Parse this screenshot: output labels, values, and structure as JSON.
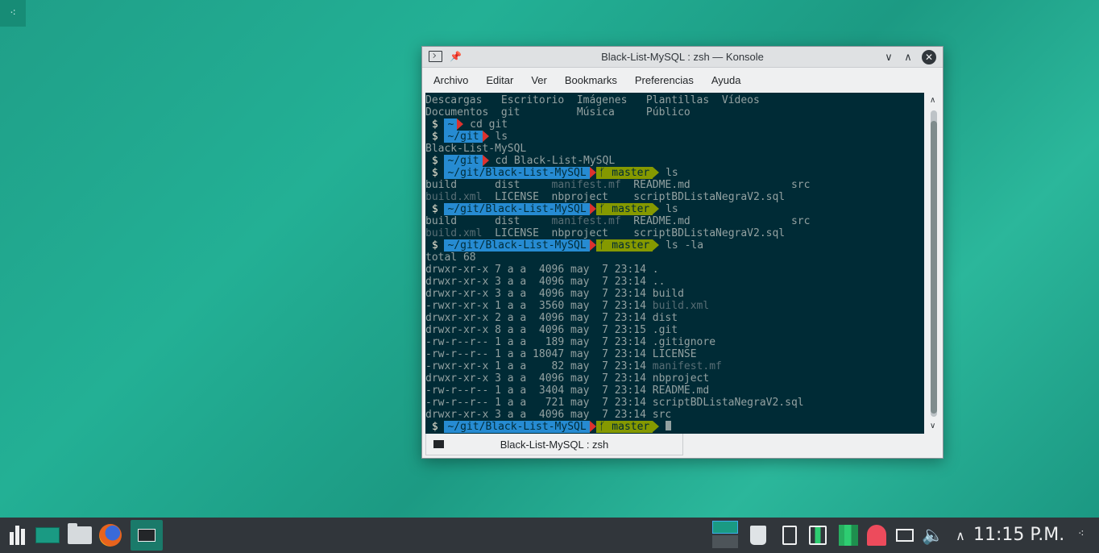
{
  "desktop": {
    "corner_icon": "desktop-toolbox-icon"
  },
  "window": {
    "title": "Black-List-MySQL : zsh — Konsole",
    "menu": [
      "Archivo",
      "Editar",
      "Ver",
      "Bookmarks",
      "Preferencias",
      "Ayuda"
    ],
    "tab_label": "Black-List-MySQL : zsh"
  },
  "terminal": {
    "plain1": [
      {
        "text": "Descargas   Escritorio  Imágenes   Plantillas  Vídeos"
      },
      {
        "text": "Documentos  git         Música     Público"
      }
    ],
    "prompts": {
      "dollar": " $ ",
      "home": "~",
      "git": "~/git",
      "repo": "~/git/Black-List-MySQL",
      "branch": "ᚶ master"
    },
    "cmds": {
      "c1": " cd git",
      "c2": " ls",
      "c3": " cd Black-List-MySQL",
      "c4": " ls",
      "c5": " ls",
      "c6": " ls -la"
    },
    "out_git": "Black-List-MySQL",
    "ls1": {
      "a": "build      dist     ",
      "b": "manifest.mf",
      "c": "  README.md                src"
    },
    "ls2": {
      "a": "build.xml",
      "b": "  LICENSE  nbproject    scriptBDListaNegraV2.sql"
    },
    "total": "total 68",
    "la": [
      {
        "perm": "drwxr-xr-x 7 a a  4096 may  7 23:14 ",
        "name": ".",
        "dim": false
      },
      {
        "perm": "drwxr-xr-x 3 a a  4096 may  7 23:14 ",
        "name": "..",
        "dim": false
      },
      {
        "perm": "drwxr-xr-x 3 a a  4096 may  7 23:14 ",
        "name": "build",
        "dim": false
      },
      {
        "perm": "-rwxr-xr-x 1 a a  3560 may  7 23:14 ",
        "name": "build.xml",
        "dim": true
      },
      {
        "perm": "drwxr-xr-x 2 a a  4096 may  7 23:14 ",
        "name": "dist",
        "dim": false
      },
      {
        "perm": "drwxr-xr-x 8 a a  4096 may  7 23:15 ",
        "name": ".git",
        "dim": false
      },
      {
        "perm": "-rw-r--r-- 1 a a   189 may  7 23:14 ",
        "name": ".gitignore",
        "dim": false
      },
      {
        "perm": "-rw-r--r-- 1 a a 18047 may  7 23:14 ",
        "name": "LICENSE",
        "dim": false
      },
      {
        "perm": "-rwxr-xr-x 1 a a    82 may  7 23:14 ",
        "name": "manifest.mf",
        "dim": true
      },
      {
        "perm": "drwxr-xr-x 3 a a  4096 may  7 23:14 ",
        "name": "nbproject",
        "dim": false
      },
      {
        "perm": "-rw-r--r-- 1 a a  3404 may  7 23:14 ",
        "name": "README.md",
        "dim": false
      },
      {
        "perm": "-rw-r--r-- 1 a a   721 may  7 23:14 ",
        "name": "scriptBDListaNegraV2.sql",
        "dim": false
      },
      {
        "perm": "drwxr-xr-x 3 a a  4096 may  7 23:14 ",
        "name": "src",
        "dim": false
      }
    ]
  },
  "taskbar": {
    "clock": "11:15 P.M.",
    "apps": [
      "application-launcher-icon",
      "desktop-icon",
      "folder-icon",
      "firefox-icon",
      "konsole-icon"
    ],
    "tray": [
      "trash-icon",
      "clipboard-icon",
      "battery-icon",
      "system-monitor-icon",
      "ghost-icon",
      "network-icon",
      "volume-icon",
      "chevron-up-icon"
    ]
  },
  "colors": {
    "desktop": "#1fa58b",
    "panel": "#31363b",
    "terminal_bg": "#002b36",
    "prompt_path": "#268bd2",
    "prompt_git": "#859900",
    "prompt_arrow": "#dc322f"
  }
}
